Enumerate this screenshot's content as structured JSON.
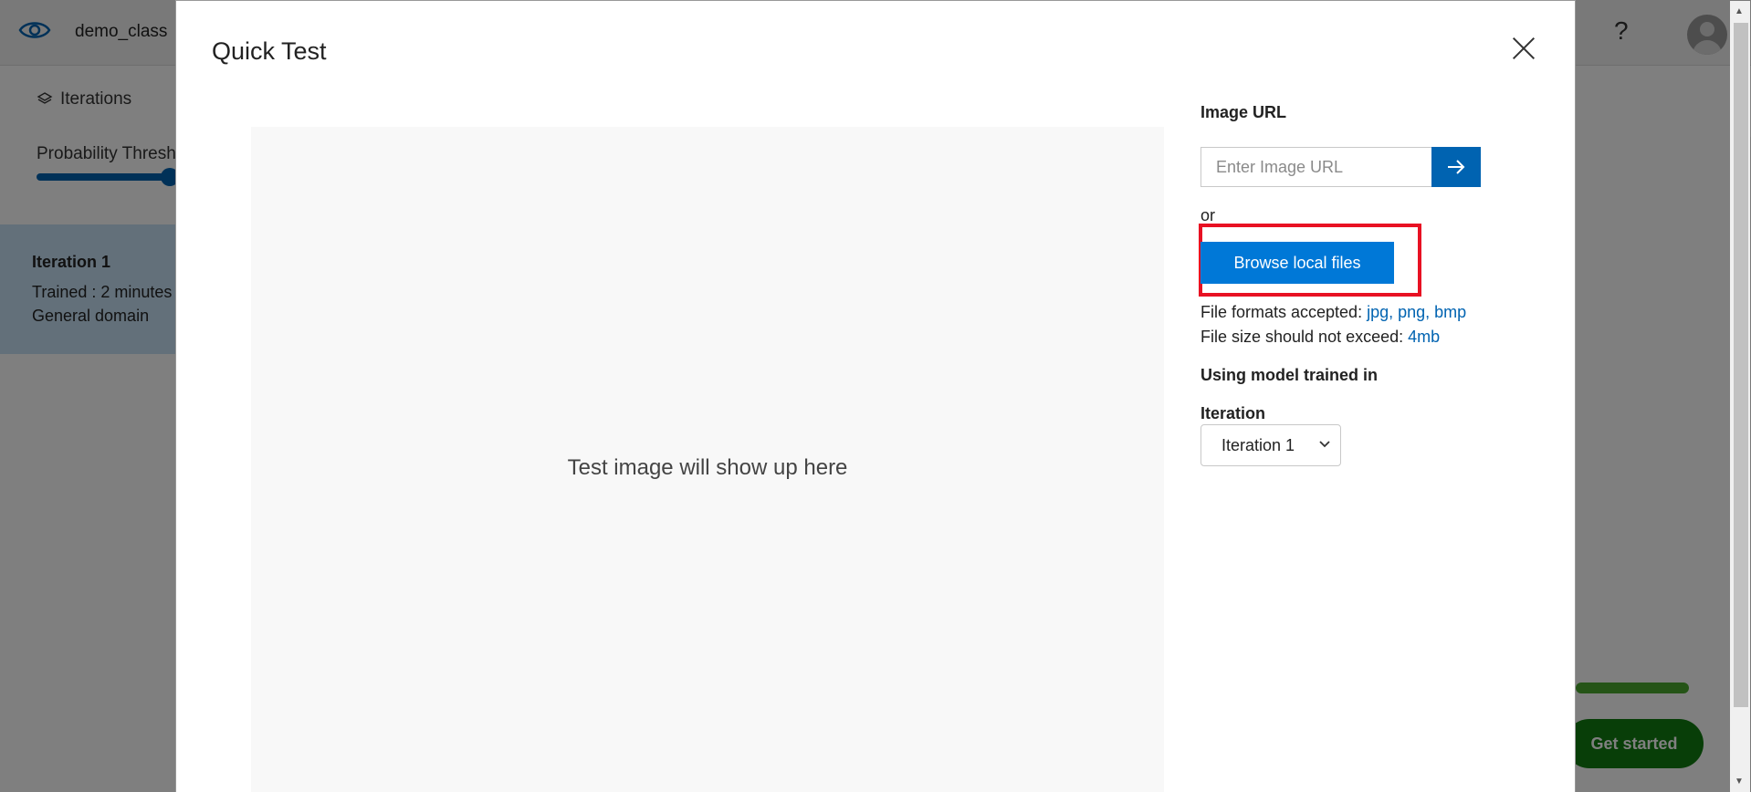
{
  "background": {
    "project_name": "demo_class",
    "help_label": "?",
    "iterations_label": "Iterations",
    "threshold_label": "Probability Thresho",
    "iteration_card": {
      "title": "Iteration 1",
      "trained": "Trained : 2 minutes",
      "domain": "General domain"
    },
    "get_started_label": "Get started"
  },
  "modal": {
    "title": "Quick Test",
    "preview_text": "Test image will show up here",
    "image_url_label": "Image URL",
    "image_url_placeholder": "Enter Image URL",
    "or_text": "or",
    "browse_button_label": "Browse local files",
    "formats_prefix": "File formats accepted: ",
    "formats_value": "jpg, png, bmp",
    "size_prefix": "File size should not exceed: ",
    "size_value": "4mb",
    "model_label": "Using model trained in",
    "iteration_label": "Iteration",
    "iteration_selected": "Iteration 1"
  },
  "colors": {
    "accent": "#0078d7",
    "accent_dark": "#0063b1",
    "highlight": "#e81123",
    "get_started": "#107c10"
  },
  "icons": [
    "eye-logo-icon",
    "layers-icon",
    "help-icon",
    "avatar-icon",
    "close-icon",
    "arrow-right-icon",
    "chevron-down-icon"
  ]
}
